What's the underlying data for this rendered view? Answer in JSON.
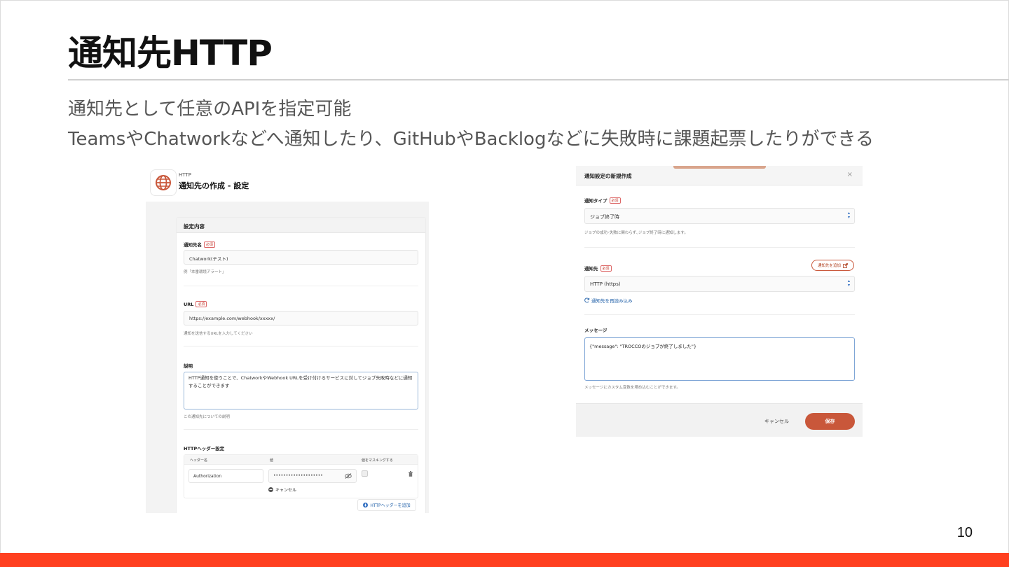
{
  "slide": {
    "title": "通知先HTTP",
    "subtitle_1": "通知先として任意のAPIを指定可能",
    "subtitle_2": "TeamsやChatworkなどへ通知したり、GitHubやBacklogなどに失敗時に課題起票したりができる",
    "page_number": "10",
    "accent_color": "#ff4020"
  },
  "left_screen": {
    "header_small": "HTTP",
    "header_title": "通知先の作成 - 設定",
    "header_icon": "globe-icon",
    "section_title": "設定内容",
    "required_badge": "必須",
    "name_label": "通知先名",
    "name_value": "Chatwork(テスト)",
    "name_help": "例「本番環境アラート」",
    "url_label": "URL",
    "url_value": "https://example.com/webhook/xxxxx/",
    "url_help": "通知を送信するURLを入力してください",
    "desc_label": "説明",
    "desc_value": "HTTP通知を使うことで、ChatworkやWebhook URLを受け付けるサービスに対してジョブ失敗時などに通知することができます",
    "desc_help": "この通知先についての説明",
    "headers_label": "HTTPヘッダー設定",
    "headers_columns": [
      "ヘッダー名",
      "値",
      "値をマスキングする"
    ],
    "header_name_value": "Authorization",
    "header_value_masked": "••••••••••••••••••••",
    "header_cancel": "キャンセル",
    "add_header_button": "HTTPヘッダーを追加"
  },
  "right_screen": {
    "modal_title": "通知設定の新規作成",
    "required_badge": "必須",
    "type_label": "通知タイプ",
    "type_value": "ジョブ終了時",
    "type_help": "ジョブの成功･失敗に関わらず､ジョブ終了時に通知します。",
    "dest_label": "通知先",
    "add_dest_button": "通知先を追加",
    "dest_value": "HTTP (https)",
    "reload_link": "通知先を再読み込み",
    "message_label": "メッセージ",
    "message_value": "{\"message\": \"TROCCOのジョブが終了しました\"}",
    "message_help": "メッセージにカスタム変数を埋め込むことができます。",
    "cancel_button": "キャンセル",
    "save_button": "保存",
    "brand_color": "#c9573a"
  }
}
